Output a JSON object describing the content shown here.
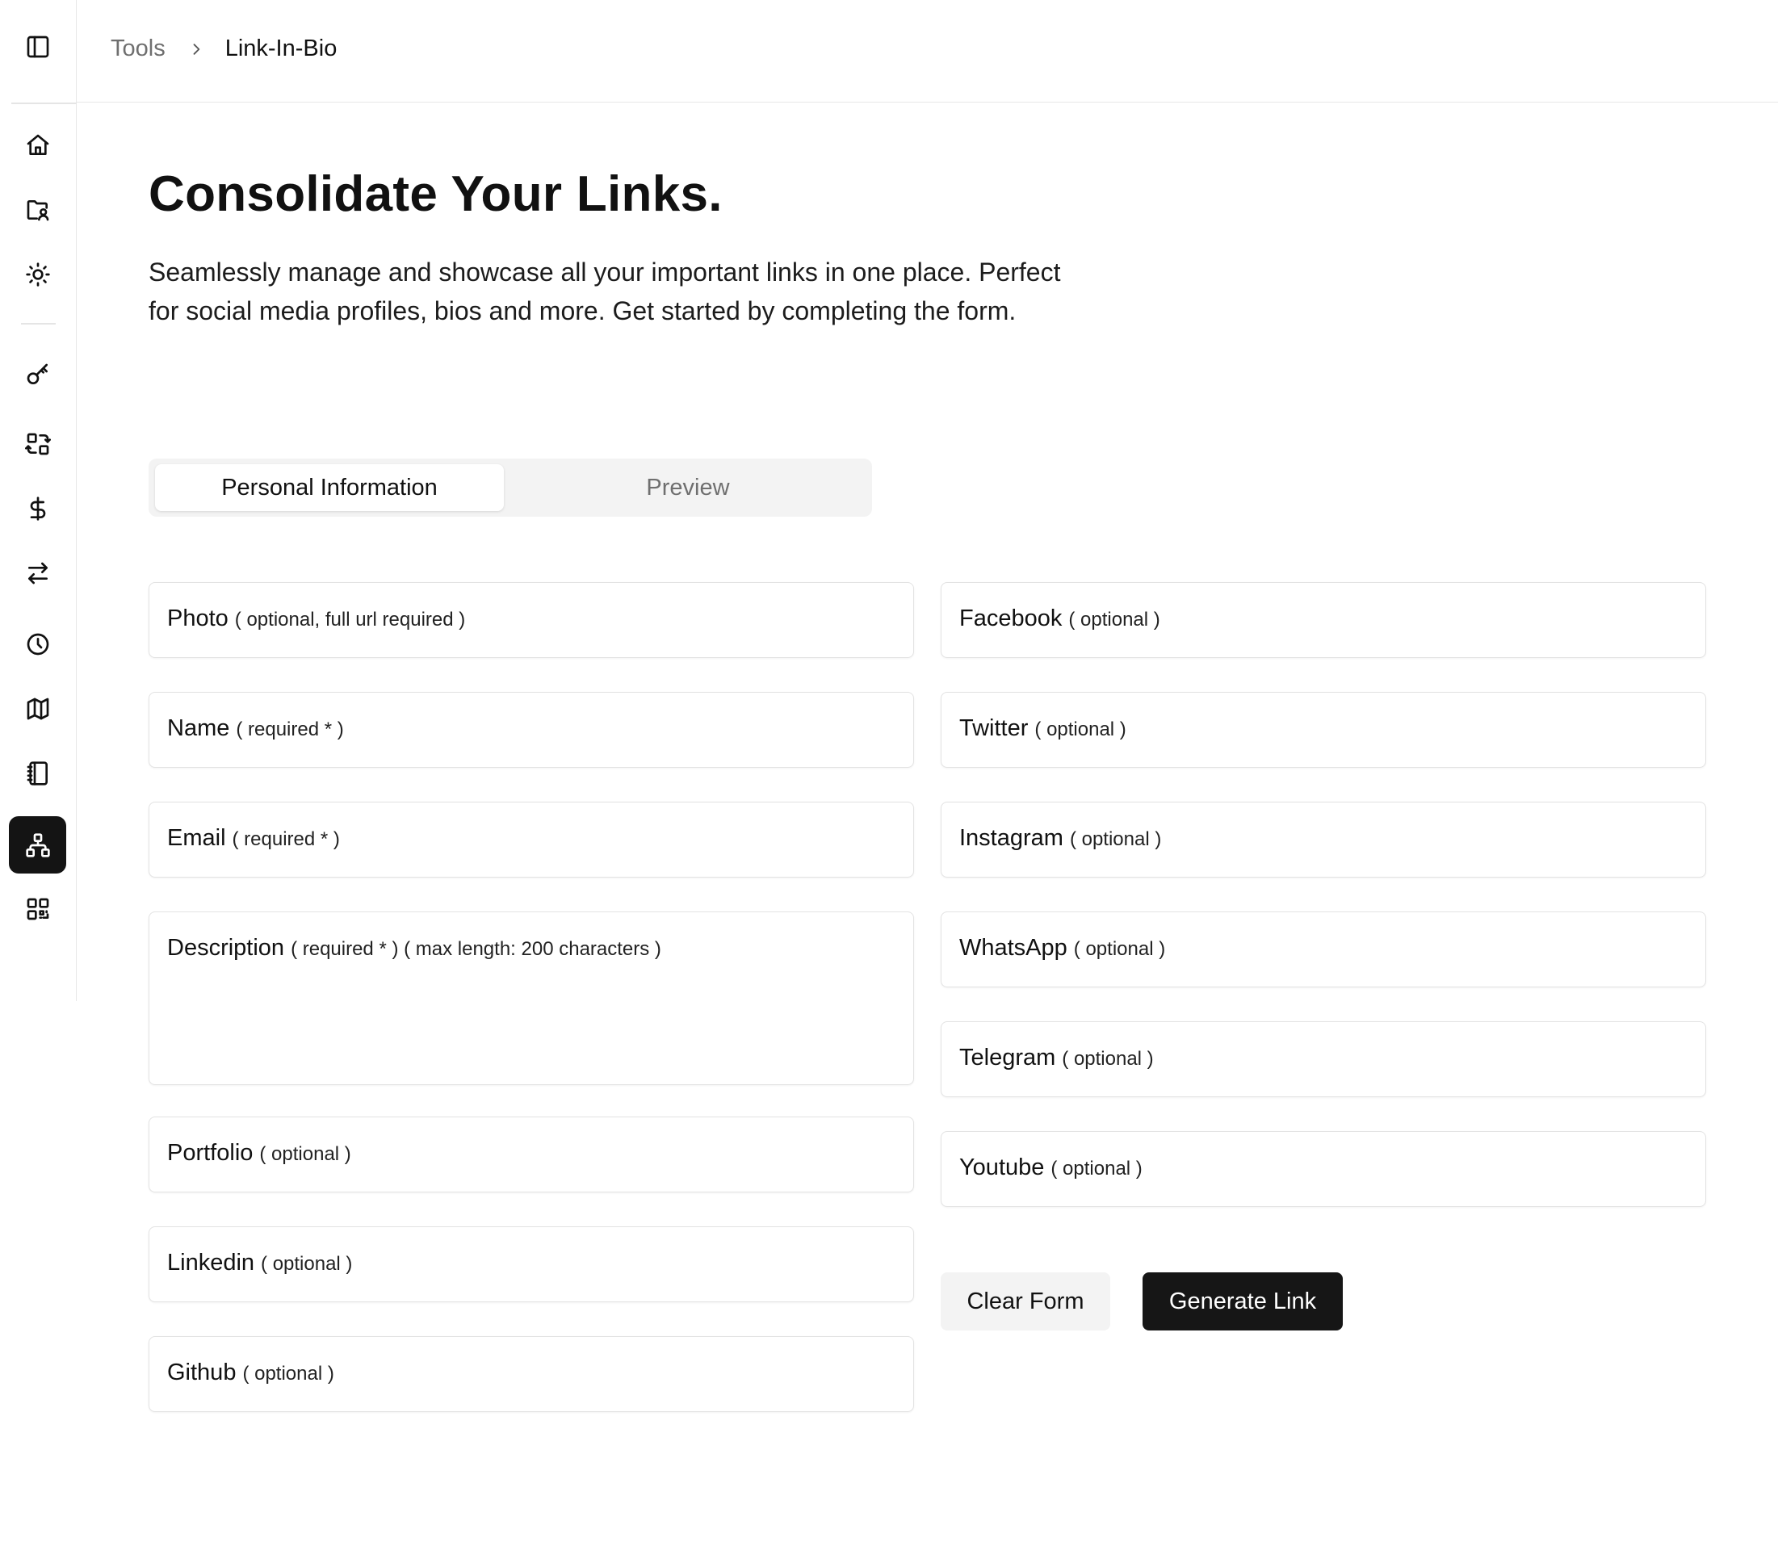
{
  "breadcrumb": {
    "root": "Tools",
    "current": "Link-In-Bio"
  },
  "sidebar": {
    "toggle_icon": "sidebar-toggle-icon",
    "items": [
      {
        "name": "home",
        "icon": "home-icon",
        "active": false
      },
      {
        "name": "folder-user",
        "icon": "folder-user-icon",
        "active": false
      },
      {
        "name": "theme",
        "icon": "sun-icon",
        "active": false
      },
      {
        "name": "password",
        "icon": "key-icon",
        "active": false
      },
      {
        "name": "converter",
        "icon": "arrows-exchange-icon",
        "active": false
      },
      {
        "name": "currency",
        "icon": "dollar-icon",
        "active": false
      },
      {
        "name": "transfer",
        "icon": "transfer-icon",
        "active": false
      },
      {
        "name": "time",
        "icon": "clock-icon",
        "active": false
      },
      {
        "name": "map",
        "icon": "map-icon",
        "active": false
      },
      {
        "name": "notebook",
        "icon": "notebook-icon",
        "active": false
      },
      {
        "name": "link-in-bio",
        "icon": "sitemap-icon",
        "active": true
      },
      {
        "name": "qr-code",
        "icon": "qr-code-icon",
        "active": false
      }
    ]
  },
  "page": {
    "title": "Consolidate Your Links.",
    "description": "Seamlessly manage and showcase all your important links in one place. Perfect for social media profiles, bios and more. Get started by completing the form."
  },
  "tabs": {
    "active": "Personal Information",
    "inactive": "Preview"
  },
  "form": {
    "left": [
      {
        "label": "Photo",
        "hint": "( optional, full url required )"
      },
      {
        "label": "Name",
        "hint": "( required * )"
      },
      {
        "label": "Email",
        "hint": "( required * )"
      },
      {
        "label": "Description",
        "hint": "( required * ) ( max length: 200 characters )"
      },
      {
        "label": "Portfolio",
        "hint": "( optional )"
      },
      {
        "label": "Linkedin",
        "hint": "( optional )"
      },
      {
        "label": "Github",
        "hint": "( optional )"
      }
    ],
    "right": [
      {
        "label": "Facebook",
        "hint": "( optional )"
      },
      {
        "label": "Twitter",
        "hint": "( optional )"
      },
      {
        "label": "Instagram",
        "hint": "( optional )"
      },
      {
        "label": "WhatsApp",
        "hint": "( optional )"
      },
      {
        "label": "Telegram",
        "hint": "( optional )"
      },
      {
        "label": "Youtube",
        "hint": "( optional )"
      }
    ]
  },
  "buttons": {
    "clear": "Clear Form",
    "generate": "Generate Link"
  },
  "colors": {
    "accent": "#141414",
    "border": "#e3e3e3",
    "muted_text": "#6f6f6f",
    "tab_bg": "#f3f3f3"
  }
}
